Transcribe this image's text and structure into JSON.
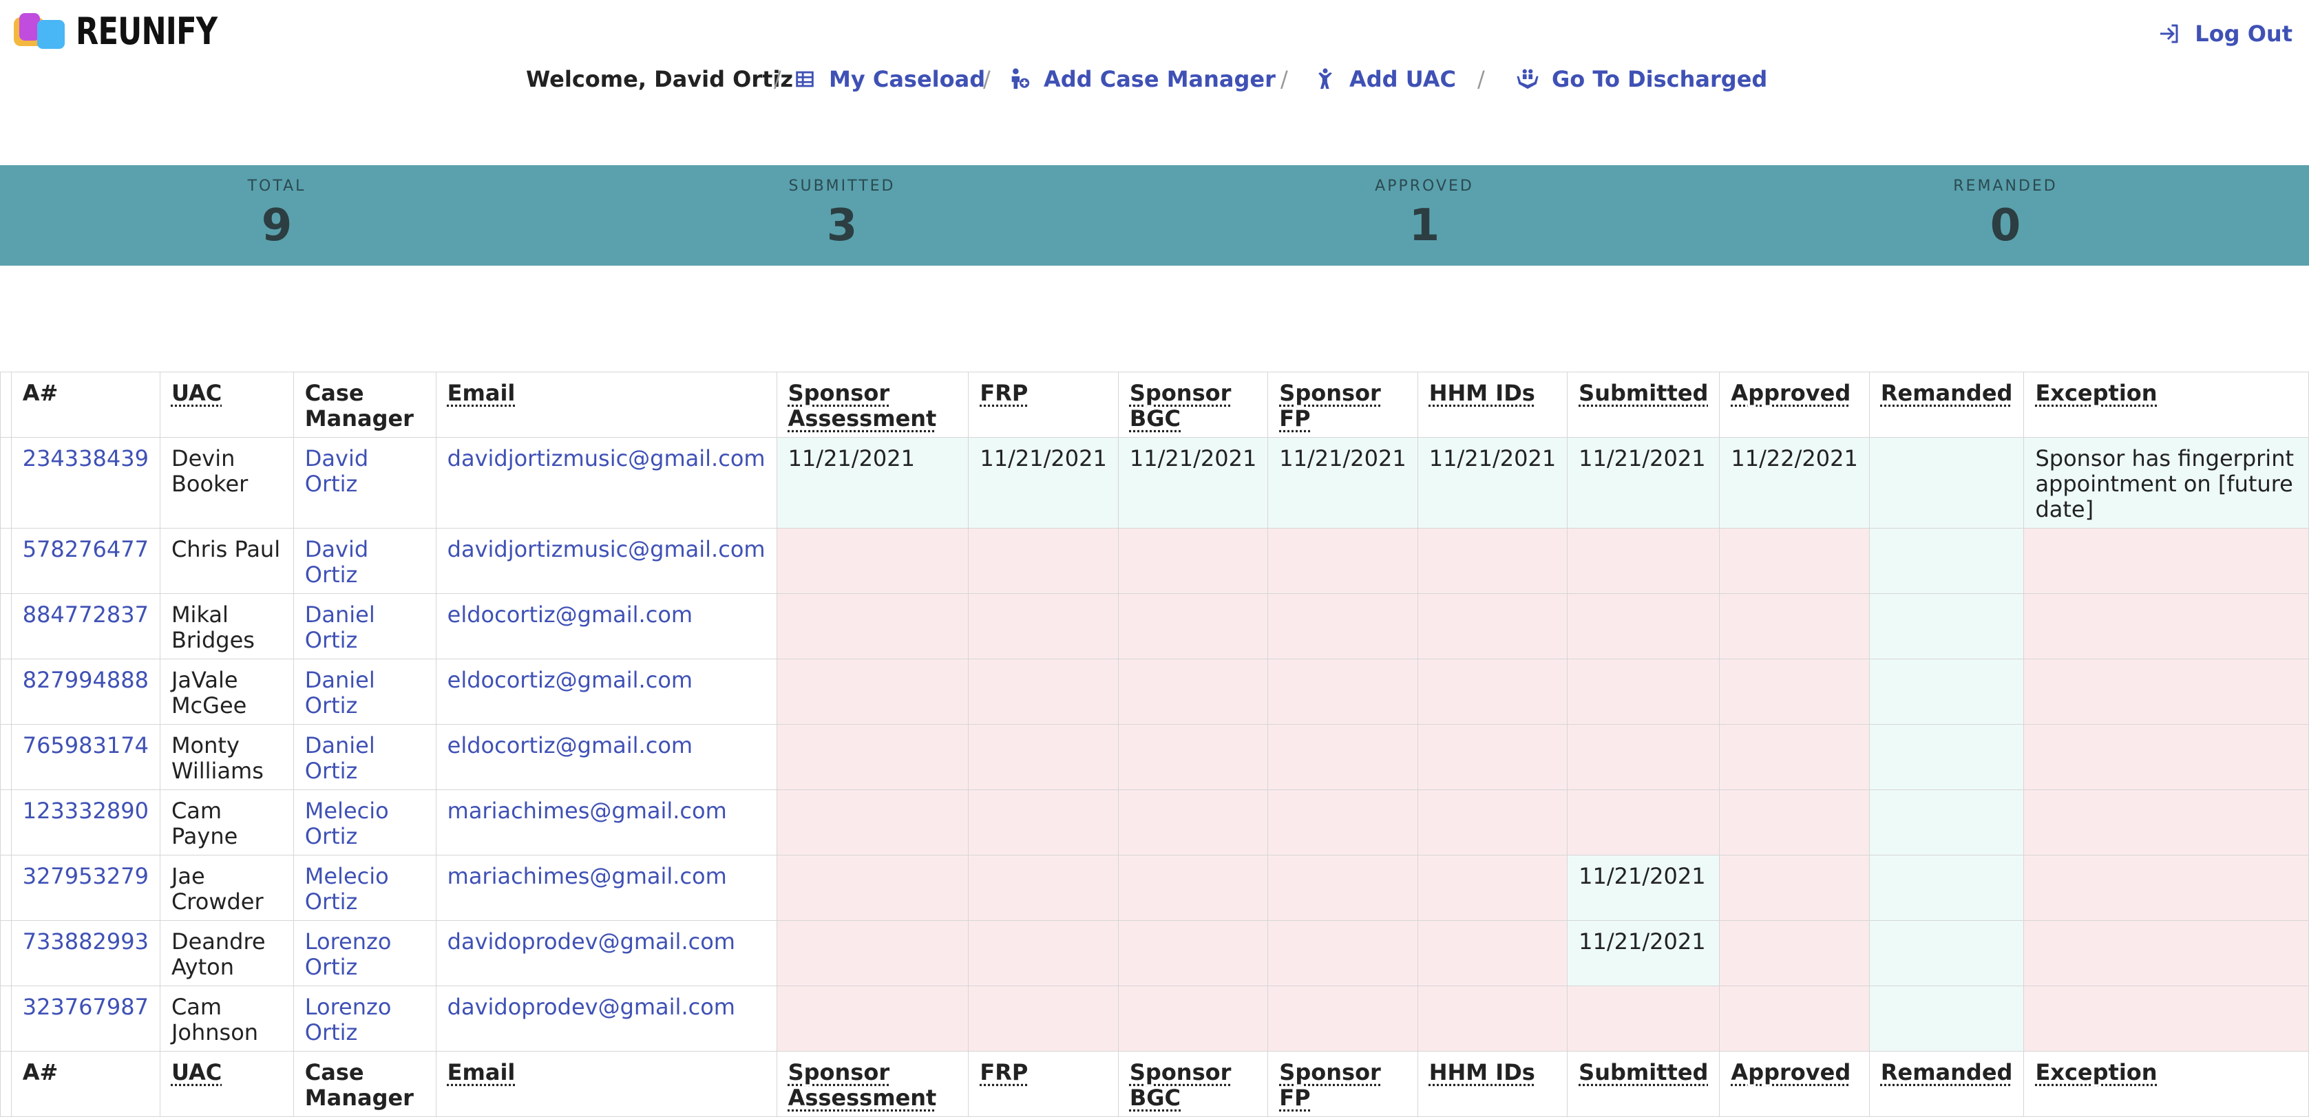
{
  "app": {
    "name": "REUNIFY"
  },
  "header": {
    "logout_label": "Log Out",
    "welcome": "Welcome, David Ortiz",
    "nav": [
      {
        "label": "My Caseload",
        "icon": "table-icon"
      },
      {
        "label": "Add Case Manager",
        "icon": "add-person-icon"
      },
      {
        "label": "Add UAC",
        "icon": "child-icon"
      },
      {
        "label": "Go To Discharged",
        "icon": "hands-people-icon"
      }
    ],
    "separator": "/"
  },
  "stats": [
    {
      "label": "TOTAL",
      "value": "9"
    },
    {
      "label": "SUBMITTED",
      "value": "3"
    },
    {
      "label": "APPROVED",
      "value": "1"
    },
    {
      "label": "REMANDED",
      "value": "0"
    }
  ],
  "colors": {
    "accent": "#3f51b5",
    "band": "#5aa1ad",
    "mint": "#eefaf8",
    "pink": "#fbeaec"
  },
  "table": {
    "columns": [
      "A#",
      "UAC",
      "Case Manager",
      "Email",
      "Sponsor Assessment",
      "FRP",
      "Sponsor BGC",
      "Sponsor FP",
      "HHM IDs",
      "Submitted",
      "Approved",
      "Remanded",
      "Exception"
    ],
    "rows": [
      {
        "a_num": "234338439",
        "uac": "Devin Booker",
        "case_manager": "David Ortiz",
        "email": "davidjortizmusic@gmail.com",
        "sponsor_assessment": "11/21/2021",
        "frp": "11/21/2021",
        "sponsor_bgc": "11/21/2021",
        "sponsor_fp": "11/21/2021",
        "hhm_ids": "11/21/2021",
        "submitted": "11/21/2021",
        "approved": "11/22/2021",
        "remanded": "",
        "exception": "Sponsor has fingerprint appointment on [future date]"
      },
      {
        "a_num": "578276477",
        "uac": "Chris Paul",
        "case_manager": "David Ortiz",
        "email": "davidjortizmusic@gmail.com",
        "sponsor_assessment": "",
        "frp": "",
        "sponsor_bgc": "",
        "sponsor_fp": "",
        "hhm_ids": "",
        "submitted": "",
        "approved": "",
        "remanded": "",
        "exception": ""
      },
      {
        "a_num": "884772837",
        "uac": "Mikal Bridges",
        "case_manager": "Daniel Ortiz",
        "email": "eldocortiz@gmail.com",
        "sponsor_assessment": "",
        "frp": "",
        "sponsor_bgc": "",
        "sponsor_fp": "",
        "hhm_ids": "",
        "submitted": "",
        "approved": "",
        "remanded": "",
        "exception": ""
      },
      {
        "a_num": "827994888",
        "uac": "JaVale McGee",
        "case_manager": "Daniel Ortiz",
        "email": "eldocortiz@gmail.com",
        "sponsor_assessment": "",
        "frp": "",
        "sponsor_bgc": "",
        "sponsor_fp": "",
        "hhm_ids": "",
        "submitted": "",
        "approved": "",
        "remanded": "",
        "exception": ""
      },
      {
        "a_num": "765983174",
        "uac": "Monty Williams",
        "case_manager": "Daniel Ortiz",
        "email": "eldocortiz@gmail.com",
        "sponsor_assessment": "",
        "frp": "",
        "sponsor_bgc": "",
        "sponsor_fp": "",
        "hhm_ids": "",
        "submitted": "",
        "approved": "",
        "remanded": "",
        "exception": ""
      },
      {
        "a_num": "123332890",
        "uac": "Cam Payne",
        "case_manager": "Melecio Ortiz",
        "email": "mariachimes@gmail.com",
        "sponsor_assessment": "",
        "frp": "",
        "sponsor_bgc": "",
        "sponsor_fp": "",
        "hhm_ids": "",
        "submitted": "",
        "approved": "",
        "remanded": "",
        "exception": ""
      },
      {
        "a_num": "327953279",
        "uac": "Jae Crowder",
        "case_manager": "Melecio Ortiz",
        "email": "mariachimes@gmail.com",
        "sponsor_assessment": "",
        "frp": "",
        "sponsor_bgc": "",
        "sponsor_fp": "",
        "hhm_ids": "",
        "submitted": "11/21/2021",
        "approved": "",
        "remanded": "",
        "exception": ""
      },
      {
        "a_num": "733882993",
        "uac": "Deandre Ayton",
        "case_manager": "Lorenzo Ortiz",
        "email": "davidoprodev@gmail.com",
        "sponsor_assessment": "",
        "frp": "",
        "sponsor_bgc": "",
        "sponsor_fp": "",
        "hhm_ids": "",
        "submitted": "11/21/2021",
        "approved": "",
        "remanded": "",
        "exception": ""
      },
      {
        "a_num": "323767987",
        "uac": "Cam Johnson",
        "case_manager": "Lorenzo Ortiz",
        "email": "davidoprodev@gmail.com",
        "sponsor_assessment": "",
        "frp": "",
        "sponsor_bgc": "",
        "sponsor_fp": "",
        "hhm_ids": "",
        "submitted": "",
        "approved": "",
        "remanded": "",
        "exception": ""
      }
    ]
  }
}
